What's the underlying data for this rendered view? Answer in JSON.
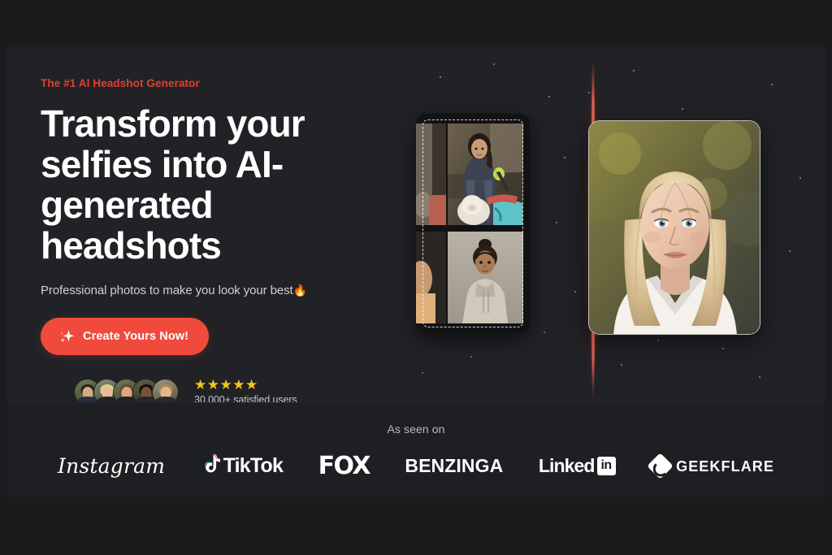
{
  "hero": {
    "eyebrow": "The #1 AI Headshot Generator",
    "headline": "Transform your selfies into AI-generated headshots",
    "subheadline": "Professional photos to make you look your best",
    "subheadline_emoji": "🔥",
    "cta_label": "Create Yours Now!",
    "cta_icon": "sparkle-icon",
    "accent_color": "#f04a3c",
    "eyebrow_color": "#e2402f",
    "background_color": "#212226"
  },
  "social_proof": {
    "avatar_count": 5,
    "avatars": [
      {
        "name": "avatar-1"
      },
      {
        "name": "avatar-2"
      },
      {
        "name": "avatar-3"
      },
      {
        "name": "avatar-4"
      },
      {
        "name": "avatar-5"
      }
    ],
    "stars": "★★★★★",
    "star_count": 5,
    "star_color": "#f5c518",
    "user_count_label": "30,000+ satisfied users"
  },
  "artwork": {
    "film_strip_label": "selfie-film-strip",
    "selfie_photos": 2,
    "scan_beam_label": "red-scan-beam",
    "scan_beam_color": "#e23426",
    "headshot_label": "ai-generated-headshot"
  },
  "as_seen_on": {
    "label": "As seen on",
    "logos": [
      {
        "name": "instagram",
        "text": "Instagram"
      },
      {
        "name": "tiktok",
        "text": "TikTok"
      },
      {
        "name": "fox",
        "text": "FOX"
      },
      {
        "name": "benzinga",
        "text": "BENZINGA"
      },
      {
        "name": "linkedin",
        "text": "Linked",
        "badge": "in"
      },
      {
        "name": "geekflare",
        "text": "GEEKFLARE"
      }
    ]
  }
}
